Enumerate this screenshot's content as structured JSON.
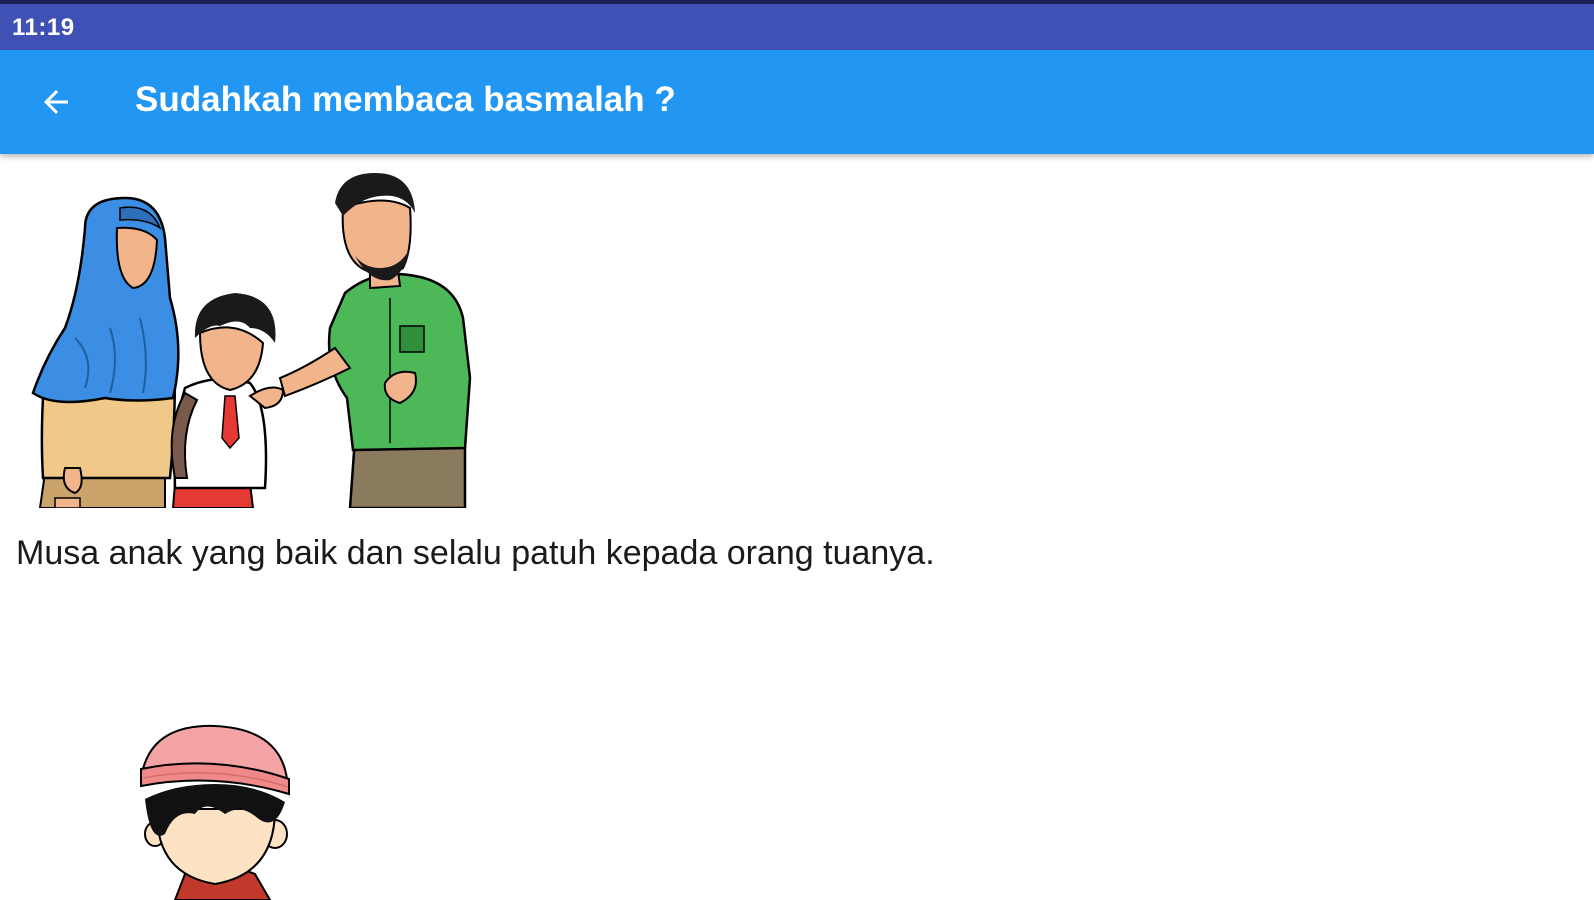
{
  "status_bar": {
    "time": "11:19",
    "color": "#3f51b5"
  },
  "app_bar": {
    "title": "Sudahkah membaca basmalah ?",
    "back_icon": "arrow-left-icon",
    "color": "#2196f3"
  },
  "story": {
    "text": "Musa anak yang baik dan selalu patuh kepada orang tuanya.",
    "illustrations": [
      "family-illustration",
      "boy-with-cap-illustration"
    ]
  }
}
